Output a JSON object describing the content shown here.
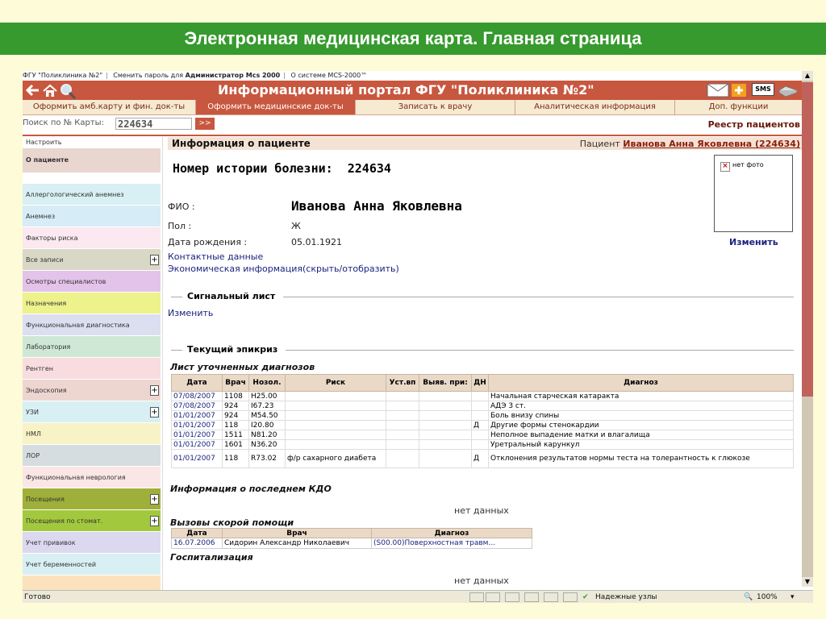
{
  "slide_title": "Электронная медицинская карта. Главная страница",
  "topline": {
    "org": "ФГУ \"Поликлиника №2\"",
    "change_pwd": "Сменить пароль для",
    "user": "Администратор Mcs 2000",
    "about": "О системе MCS-2000™"
  },
  "header": {
    "title": "Информационный портал ФГУ \"Поликлиника №2\"",
    "sms": "SMS"
  },
  "menu": [
    "Оформить амб.карту и фин. док-ты",
    "Оформить медицинские док-ты",
    "Записать к врачу",
    "Аналитическая информация",
    "Доп. функции"
  ],
  "search": {
    "label": "Поиск по № Карты:",
    "value": "224634",
    "button": ">>",
    "registry": "Реестр пациентов"
  },
  "sidebar": [
    {
      "label": "Настроить",
      "plus": false
    },
    {
      "label": "О пациенте",
      "plus": false
    },
    {
      "label": "Аллергологический анемнез",
      "plus": false
    },
    {
      "label": "Анемнез",
      "plus": false
    },
    {
      "label": "Факторы риска",
      "plus": false
    },
    {
      "label": "Все записи",
      "plus": true
    },
    {
      "label": "Осмотры специалистов",
      "plus": false
    },
    {
      "label": "Назначения",
      "plus": false
    },
    {
      "label": "Функциональная диагностика",
      "plus": false
    },
    {
      "label": "Лаборатория",
      "plus": false
    },
    {
      "label": "Рентген",
      "plus": false
    },
    {
      "label": "Эндоскопия",
      "plus": true
    },
    {
      "label": "УЗИ",
      "plus": true
    },
    {
      "label": "НМЛ",
      "plus": false
    },
    {
      "label": "ЛОР",
      "plus": false
    },
    {
      "label": "Функциональная неврология",
      "plus": false
    },
    {
      "label": "Посещения",
      "plus": true
    },
    {
      "label": "Посещения по стомат.",
      "plus": true
    },
    {
      "label": "Учет прививок",
      "plus": false
    },
    {
      "label": "Учет беременностей",
      "plus": false
    }
  ],
  "patient_bar": {
    "title": "Информация о пациенте",
    "prefix": "Пациент",
    "name_link": "Иванова Анна Яковлевна (224634)"
  },
  "history": {
    "label": "Номер истории болезни:",
    "number": "224634"
  },
  "photo": {
    "text": "нет фото",
    "change": "Изменить"
  },
  "patient": {
    "fio_label": "ФИО :",
    "fio": "Иванова Анна Яковлевна",
    "sex_label": "Пол :",
    "sex": "Ж",
    "dob_label": "Дата рождения :",
    "dob": "05.01.1921",
    "contacts": "Контактные данные",
    "economic": "Экономическая информация(скрыть/отобразить)"
  },
  "signal": {
    "title": "Сигнальный лист",
    "change": "Изменить"
  },
  "epicrisis": {
    "title": "Текущий эпикриз",
    "diag_title": "Лист уточненных диагнозов",
    "columns": [
      "Дата",
      "Врач",
      "Нозол.",
      "Риск",
      "Уст.вп",
      "Выяв. при:",
      "ДН",
      "Диагноз"
    ],
    "rows": [
      {
        "date": "07/08/2007",
        "doc": "1108",
        "noz": "H25.00",
        "risk": "",
        "ust": "",
        "vyav": "",
        "dn": "",
        "diag": "Начальная старческая катаракта"
      },
      {
        "date": "07/08/2007",
        "doc": "924",
        "noz": "I67.23",
        "risk": "",
        "ust": "",
        "vyav": "",
        "dn": "",
        "diag": "АДЭ 3 ст."
      },
      {
        "date": "01/01/2007",
        "doc": "924",
        "noz": "M54.50",
        "risk": "",
        "ust": "",
        "vyav": "",
        "dn": "",
        "diag": "Боль внизу спины"
      },
      {
        "date": "01/01/2007",
        "doc": "118",
        "noz": "I20.80",
        "risk": "",
        "ust": "",
        "vyav": "",
        "dn": "Д",
        "diag": "Другие формы стенокардии"
      },
      {
        "date": "01/01/2007",
        "doc": "1511",
        "noz": "N81.20",
        "risk": "",
        "ust": "",
        "vyav": "",
        "dn": "",
        "diag": "Неполное выпадение матки и влагалища"
      },
      {
        "date": "01/01/2007",
        "doc": "1601",
        "noz": "N36.20",
        "risk": "",
        "ust": "",
        "vyav": "",
        "dn": "",
        "diag": "Уретральный карункул"
      },
      {
        "date": "01/01/2007",
        "doc": "118",
        "noz": "R73.02",
        "risk": "ф/р сахарного диабета",
        "ust": "",
        "vyav": "",
        "dn": "Д",
        "diag": "Отклонения результатов нормы теста на толерантность к глюкозе"
      }
    ]
  },
  "kdo": {
    "title": "Информация о последнем КДО",
    "empty": "нет данных"
  },
  "ambulance": {
    "title": "Вызовы скорой помощи",
    "columns": [
      "Дата",
      "Врач",
      "Диагноз"
    ],
    "rows": [
      {
        "date": "16.07.2006",
        "doc": "Сидорин Александр Николаевич",
        "diag": "(S00.00)Поверхностная травм..."
      }
    ]
  },
  "hosp": {
    "title": "Госпитализация",
    "empty": "нет данных"
  },
  "status": {
    "text": "Готово",
    "zone": "Надежные узлы",
    "zoom": "100%"
  },
  "colors": {
    "accent": "#c8573f",
    "title_bar": "#369a2e",
    "link": "#1a237e"
  }
}
